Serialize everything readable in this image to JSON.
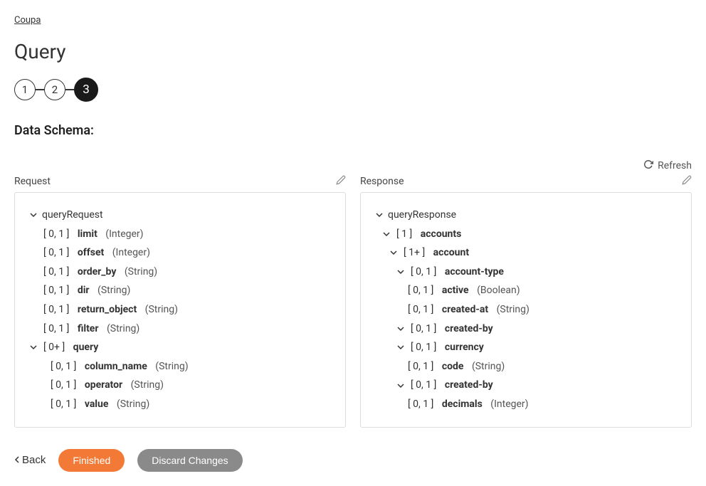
{
  "breadcrumb": "Coupa",
  "page_title": "Query",
  "steps": [
    "1",
    "2",
    "3"
  ],
  "active_step_index": 2,
  "section_title": "Data Schema:",
  "refresh_label": "Refresh",
  "request_label": "Request",
  "response_label": "Response",
  "back_label": "Back",
  "finished_label": "Finished",
  "discard_label": "Discard Changes",
  "request_tree": {
    "root": "queryRequest",
    "fields": [
      {
        "card": "[ 0, 1 ]",
        "name": "limit",
        "type": "(Integer)"
      },
      {
        "card": "[ 0, 1 ]",
        "name": "offset",
        "type": "(Integer)"
      },
      {
        "card": "[ 0, 1 ]",
        "name": "order_by",
        "type": "(String)"
      },
      {
        "card": "[ 0, 1 ]",
        "name": "dir",
        "type": "(String)"
      },
      {
        "card": "[ 0, 1 ]",
        "name": "return_object",
        "type": "(String)"
      },
      {
        "card": "[ 0, 1 ]",
        "name": "filter",
        "type": "(String)"
      }
    ],
    "query": {
      "card": "[ 0+ ]",
      "name": "query",
      "fields": [
        {
          "card": "[ 0, 1 ]",
          "name": "column_name",
          "type": "(String)"
        },
        {
          "card": "[ 0, 1 ]",
          "name": "operator",
          "type": "(String)"
        },
        {
          "card": "[ 0, 1 ]",
          "name": "value",
          "type": "(String)"
        }
      ]
    }
  },
  "response_tree": {
    "root": "queryResponse",
    "accounts": {
      "card": "[ 1 ]",
      "name": "accounts"
    },
    "account": {
      "card": "[ 1+ ]",
      "name": "account"
    },
    "account_type": {
      "card": "[ 0, 1 ]",
      "name": "account-type"
    },
    "account_type_fields": [
      {
        "card": "[ 0, 1 ]",
        "name": "active",
        "type": "(Boolean)"
      },
      {
        "card": "[ 0, 1 ]",
        "name": "created-at",
        "type": "(String)"
      }
    ],
    "created_by_1": {
      "card": "[ 0, 1 ]",
      "name": "created-by"
    },
    "currency": {
      "card": "[ 0, 1 ]",
      "name": "currency"
    },
    "currency_fields": [
      {
        "card": "[ 0, 1 ]",
        "name": "code",
        "type": "(String)"
      }
    ],
    "created_by_2": {
      "card": "[ 0, 1 ]",
      "name": "created-by"
    },
    "decimals": {
      "card": "[ 0, 1 ]",
      "name": "decimals",
      "type": "(Integer)"
    }
  }
}
